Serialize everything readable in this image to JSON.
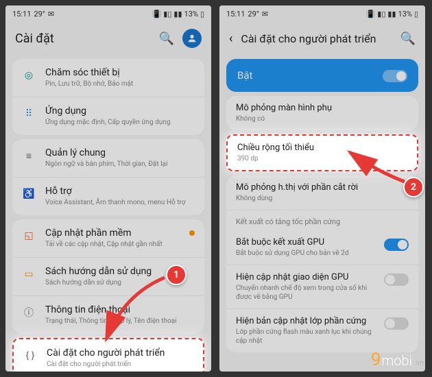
{
  "status": {
    "time": "15:11",
    "temp": "29°",
    "battery": "13%"
  },
  "left": {
    "title": "Cài đặt",
    "rows": [
      {
        "icon": "◎",
        "t": "Chăm sóc thiết bị",
        "s": "Pin, Lưu trữ, Bộ nhớ, Bảo mật"
      },
      {
        "icon": "⠿",
        "t": "Ứng dụng",
        "s": "Ứng dụng mặc định, Cấp quyền ứng dụng"
      },
      {
        "icon": "≡",
        "t": "Quản lý chung",
        "s": "Ngôn ngữ và bàn phím, Thời gian, Đặt lại"
      },
      {
        "icon": "♿",
        "t": "Hỗ trợ",
        "s": "Voice Assistant, Âm thanh mono, menu Hỗ trợ"
      },
      {
        "icon": "◱",
        "t": "Cập nhật phần mềm",
        "s": "Tải về các cập nhật, Cập nhật gần nhất"
      },
      {
        "icon": "▭",
        "t": "Sách hướng dẫn sử dụng",
        "s": "Sách hướng dẫn sử dụng"
      },
      {
        "icon": "ⓘ",
        "t": "Thông tin điện thoại",
        "s": "Trạng thái, Thông tin pháp lý, Tên điện thoại"
      },
      {
        "icon": "{ }",
        "t": "Cài đặt cho người phát triển",
        "s": "Cài đặt cho người phát triển"
      }
    ]
  },
  "right": {
    "title": "Cài đặt cho người phát triển",
    "enable": "Bật",
    "section_hw": "Kết xuất có tăng tốc phần cứng",
    "rows": [
      {
        "t": "Mô phỏng màn hình phụ",
        "s": "Không có"
      },
      {
        "t": "Chiều rộng tối thiểu",
        "s": "390 dp"
      },
      {
        "t": "Mô phỏng h.thị với phần cắt rời",
        "s": "Không dùng"
      },
      {
        "t": "Bắt buộc kết xuất GPU",
        "s": "Bắt buộc sử dụng GPU cho bản vẽ 2d"
      },
      {
        "t": "Hiện cập nhật giao diện GPU",
        "s": "Chuyển nhanh chế độ xem trong cửa sổ khi được vẽ bằng GPU"
      },
      {
        "t": "Hiện bản cập nhật lớp phần cứng",
        "s": "Lớp phần cứng flash màu xanh lục khi chúng cập nhật"
      }
    ]
  },
  "markers": {
    "m1": "1",
    "m2": "2"
  },
  "brand": {
    "nine": "9",
    "name": "mobi",
    "suffix": ".vn"
  }
}
